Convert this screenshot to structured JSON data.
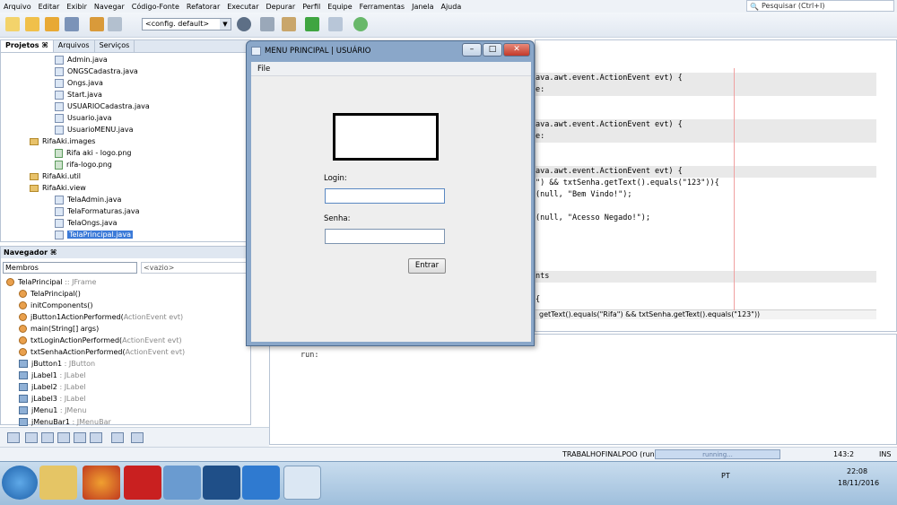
{
  "menubar": {
    "items": [
      "Arquivo",
      "Editar",
      "Exibir",
      "Navegar",
      "Código-Fonte",
      "Refatorar",
      "Executar",
      "Depurar",
      "Perfil",
      "Equipe",
      "Ferramentas",
      "Janela",
      "Ajuda"
    ]
  },
  "search": {
    "placeholder": "Pesquisar (Ctrl+I)"
  },
  "toolbar": {
    "config_value": "<config. default>"
  },
  "projects_panel": {
    "tabs": [
      "Projetos ⌘",
      "Arquivos",
      "Serviços"
    ],
    "items": [
      {
        "label": "Admin.java",
        "icon": "java-file-icon"
      },
      {
        "label": "ONGSCadastra.java",
        "icon": "java-file-icon"
      },
      {
        "label": "Ongs.java",
        "icon": "java-file-icon"
      },
      {
        "label": "Start.java",
        "icon": "java-file-icon"
      },
      {
        "label": "USUARIOCadastra.java",
        "icon": "java-file-icon"
      },
      {
        "label": "Usuario.java",
        "icon": "java-file-icon"
      },
      {
        "label": "UsuarioMENU.java",
        "icon": "java-file-icon"
      },
      {
        "label": "RifaAki.images",
        "icon": "package-icon"
      },
      {
        "label": "Rifa aki - logo.png",
        "icon": "image-file-icon"
      },
      {
        "label": "rifa-logo.png",
        "icon": "image-file-icon"
      },
      {
        "label": "RifaAki.util",
        "icon": "package-icon"
      },
      {
        "label": "RifaAki.view",
        "icon": "package-icon"
      },
      {
        "label": "TelaAdmin.java",
        "icon": "form-file-icon"
      },
      {
        "label": "TelaFormaturas.java",
        "icon": "form-file-icon"
      },
      {
        "label": "TelaOngs.java",
        "icon": "form-file-icon"
      },
      {
        "label": "TelaPrincipal.java",
        "icon": "form-file-icon"
      }
    ]
  },
  "navigator": {
    "title": "Navegador ⌘",
    "filter_value": "Membros",
    "empty_value": "<vazio>",
    "items": [
      {
        "name": "TelaPrincipal",
        "type": " :: JFrame"
      },
      {
        "name": "TelaPrincipal()",
        "type": ""
      },
      {
        "name": "initComponents()",
        "type": ""
      },
      {
        "name": "jButton1ActionPerformed(",
        "type": "ActionEvent evt)"
      },
      {
        "name": "main(String[] args)",
        "type": ""
      },
      {
        "name": "txtLoginActionPerformed(",
        "type": "ActionEvent evt)"
      },
      {
        "name": "txtSenhaActionPerformed(",
        "type": "ActionEvent evt)"
      },
      {
        "name": "jButton1",
        "type": " : JButton"
      },
      {
        "name": "jLabel1",
        "type": " : JLabel"
      },
      {
        "name": "jLabel2",
        "type": " : JLabel"
      },
      {
        "name": "jLabel3",
        "type": " : JLabel"
      },
      {
        "name": "jMenu1",
        "type": " : JMenu"
      },
      {
        "name": "jMenuBar1",
        "type": " : JMenuBar"
      }
    ]
  },
  "editor": {
    "lines": [
      "ava.awt.event.ActionEvent evt) {",
      "e:",
      "",
      "",
      "ava.awt.event.ActionEvent evt) {",
      "e:",
      "",
      "",
      "ava.awt.event.ActionEvent evt) {",
      "\") && txtSenha.getText().equals(\"123\")){",
      "(null, \"Bem Vindo!\");",
      "",
      "(null, \"Acesso Negado!\");",
      "",
      "",
      "",
      "",
      "nts",
      "",
      "{"
    ],
    "breadcrumb": "getText().equals(\"Rifa\") && txtSenha.getText().equals(\"123\"))"
  },
  "output": {
    "text": "run:"
  },
  "statusbar": {
    "project": "TRABALHOFINALPOO (run)",
    "progress": "running...",
    "position": "143:2",
    "mode": "INS"
  },
  "taskbar": {
    "lang": "PT",
    "time": "22:08",
    "date": "18/11/2016"
  },
  "dialog": {
    "title": "MENU PRINCIPAL | USUÁRIO",
    "menu": "File",
    "login_label": "Login:",
    "senha_label": "Senha:",
    "login_value": "",
    "senha_value": "",
    "button": "Entrar"
  }
}
